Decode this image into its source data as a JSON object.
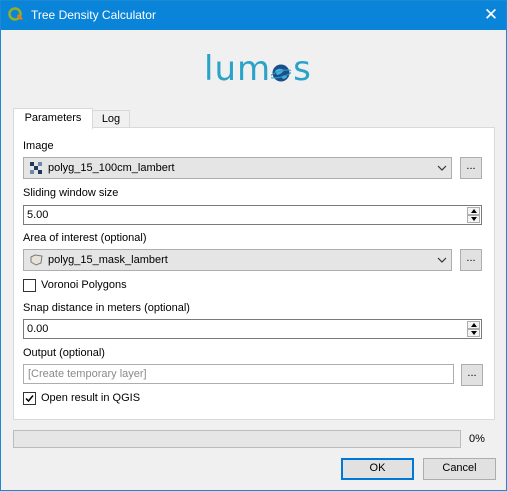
{
  "window": {
    "title": "Tree Density Calculator",
    "title_color": "#0a84d8"
  },
  "logo": {
    "text": "lum",
    "text2": "s",
    "color": "#2ba3c9"
  },
  "tabs": [
    {
      "label": "Parameters",
      "active": true
    },
    {
      "label": "Log",
      "active": false
    }
  ],
  "params": {
    "image": {
      "label": "Image",
      "value": "polyg_15_100cm_lambert",
      "icon": "raster-layer-icon",
      "browse": "..."
    },
    "sliding_window": {
      "label": "Sliding window size",
      "value": "5.00"
    },
    "aoi": {
      "label": "Area of interest (optional)",
      "value": "polyg_15_mask_lambert",
      "icon": "polygon-layer-icon",
      "browse": "..."
    },
    "voronoi": {
      "label": "Voronoi Polygons",
      "checked": false
    },
    "snap": {
      "label": "Snap distance in meters (optional)",
      "value": "0.00"
    },
    "output": {
      "label": "Output (optional)",
      "placeholder": "[Create temporary layer]",
      "browse": "..."
    },
    "open_result": {
      "label": "Open result in QGIS",
      "checked": true
    }
  },
  "progress": {
    "value": 0,
    "text": "0%",
    "fill_color": "#06b025"
  },
  "buttons": {
    "ok": "OK",
    "cancel": "Cancel"
  }
}
